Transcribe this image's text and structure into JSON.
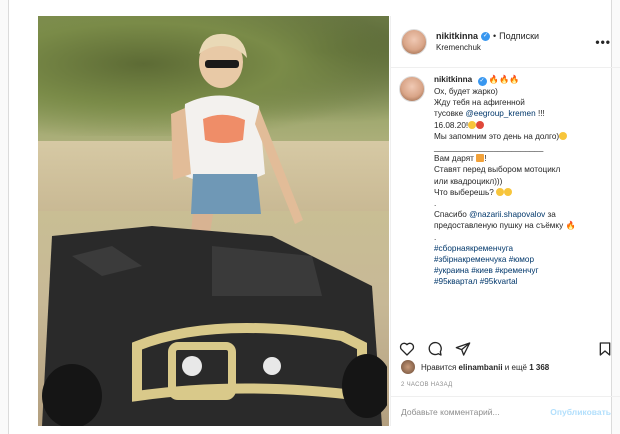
{
  "post": {
    "username": "nikitkinna",
    "follow_label": "Подписки",
    "location": "Kremenchuk",
    "more_label": "•••"
  },
  "caption": {
    "username": "nikitkinna",
    "flames": "🔥🔥🔥",
    "lines": [
      "Ох, будет жарко)",
      "Жду тебя на афигенной",
      "тусовке",
      "16.08.20!",
      "Мы запомним это день на долго)",
      "________________________",
      "Вам дарят",
      "Ставят перед выбором мотоцикл",
      "или квадроцикл)))",
      "Что выберешь?",
      ".",
      "Спасибо",
      "предоставленую пушку на съёмку",
      ".",
      "#сборнаякременчуга",
      "#збірнакременчука #юмор",
      "#украина #киев #кременчуг",
      "#95квартал #95kvartal"
    ],
    "mention_eegroup": "@eegroup_kremen",
    "mention_eegroup_suffix": "!!!",
    "mention_nazarii": "@nazarii.shapovalov",
    "mention_nazarii_suffix": "за"
  },
  "likes": {
    "prefix": "Нравится",
    "user": "elinambanii",
    "middle": "и ещё",
    "count": "1 368"
  },
  "time_ago": "2 ЧАСОВ НАЗАД",
  "comment": {
    "placeholder": "Добавьте комментарий...",
    "publish_label": "Опубликовать"
  },
  "colors": {
    "link": "#00376b",
    "verified": "#3897f0",
    "publish_disabled": "#b2dffc"
  }
}
